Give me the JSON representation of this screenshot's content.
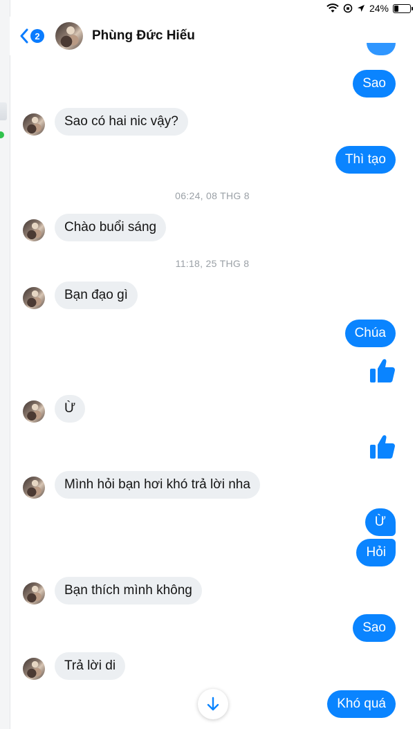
{
  "status_bar": {
    "battery": "24%",
    "battery_level": 0.24
  },
  "header": {
    "back_badge": "2",
    "contact_name": "Phùng Đức Hiếu"
  },
  "messages": [
    {
      "kind": "out",
      "text": "Sao"
    },
    {
      "kind": "in",
      "text": "Sao có hai nic vậy?"
    },
    {
      "kind": "out",
      "text": "Thì tạo"
    },
    {
      "kind": "timestamp",
      "text": "06:24, 08 THG 8"
    },
    {
      "kind": "in",
      "text": "Chào buổi sáng"
    },
    {
      "kind": "timestamp",
      "text": "11:18, 25 THG 8"
    },
    {
      "kind": "in",
      "text": "Bạn đạo gì"
    },
    {
      "kind": "out",
      "text": "Chúa"
    },
    {
      "kind": "like",
      "icon": "thumbs-up-icon"
    },
    {
      "kind": "in",
      "text": "Ừ"
    },
    {
      "kind": "like",
      "icon": "thumbs-up-icon"
    },
    {
      "kind": "in",
      "text": "Mình hỏi bạn hơi khó trả lời nha"
    },
    {
      "kind": "out",
      "text": "Ừ"
    },
    {
      "kind": "out",
      "text": "Hỏi"
    },
    {
      "kind": "in",
      "text": "Bạn thích mình không"
    },
    {
      "kind": "out",
      "text": "Sao"
    },
    {
      "kind": "in",
      "text": "Trả lời di"
    },
    {
      "kind": "out",
      "text": "Khó quá"
    }
  ],
  "colors": {
    "accent": "#0a84ff",
    "incoming_bubble": "#eceff2",
    "online": "#31c24d"
  }
}
